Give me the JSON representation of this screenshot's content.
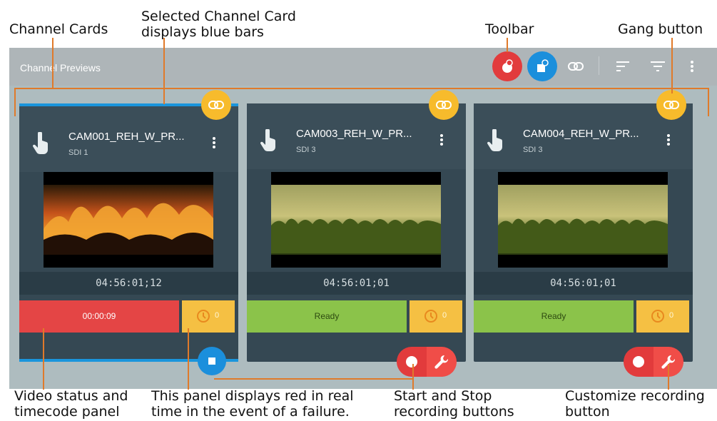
{
  "callouts": {
    "channel_cards": "Channel Cards",
    "selected_card": "Selected Channel Card\ndisplays blue bars",
    "toolbar": "Toolbar",
    "gang_button": "Gang button",
    "video_status": "Video status and\ntimecode panel",
    "failure_panel": "This panel displays red in real\ntime in the event of a failure.",
    "start_stop": "Start and Stop\nrecording buttons",
    "customize": "Customize recording\nbutton"
  },
  "app": {
    "title": "Channel Previews"
  },
  "colors": {
    "blue": "#1a95dc",
    "red": "#e44545",
    "green": "#8bc34a",
    "amber": "#f5c043",
    "gang": "#f7bb2c"
  },
  "channels": [
    {
      "name": "CAM001_REH_W_PR...",
      "source": "SDI 1",
      "timecode": "04:56:01;12",
      "status": "00:00:09",
      "alert_count": "0"
    },
    {
      "name": "CAM003_REH_W_PR...",
      "source": "SDI 3",
      "timecode": "04:56:01;01",
      "status": "Ready",
      "alert_count": "0"
    },
    {
      "name": "CAM004_REH_W_PR...",
      "source": "SDI 3",
      "timecode": "04:56:01;01",
      "status": "Ready",
      "alert_count": "0"
    }
  ]
}
